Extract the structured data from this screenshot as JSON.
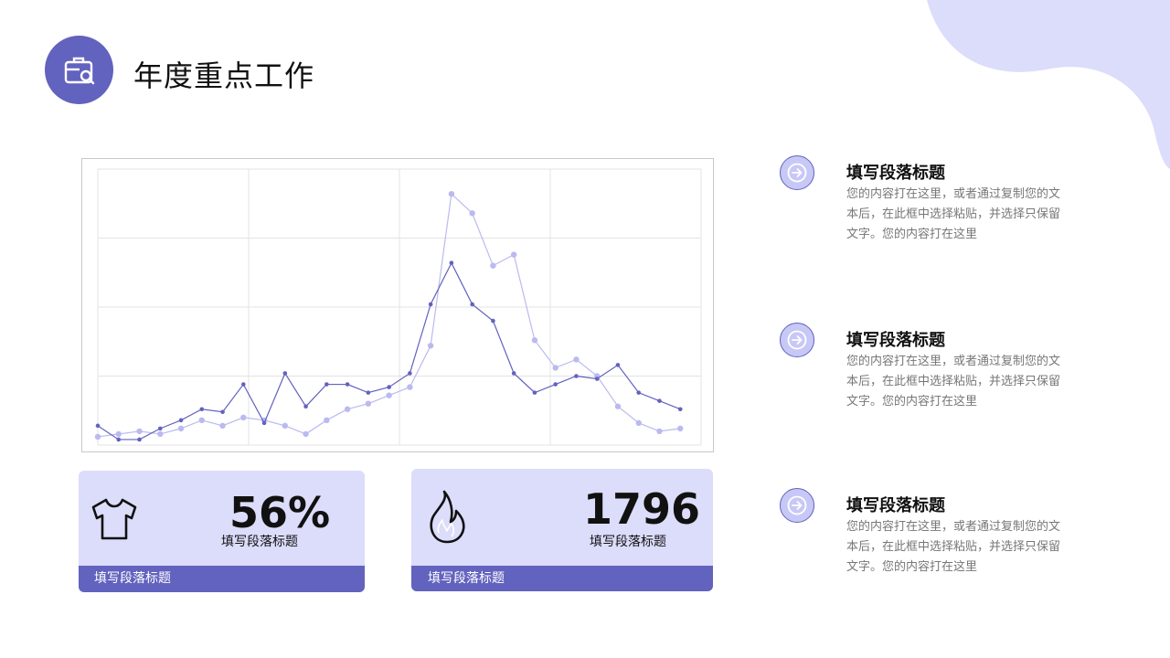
{
  "colors": {
    "accent": "#6262bf",
    "light_accent": "#dcdcfb",
    "series_light": "#babaf0"
  },
  "header": {
    "title": "年度重点工作",
    "icon": "briefcase-search-icon"
  },
  "chart_data": {
    "type": "line",
    "x": [
      1,
      2,
      3,
      4,
      5,
      6,
      7,
      8,
      9,
      10,
      11,
      12,
      13,
      14,
      15,
      16,
      17,
      18,
      19,
      20,
      21,
      22,
      23,
      24,
      25,
      26,
      27,
      28,
      29,
      30
    ],
    "ylim": [
      0,
      100
    ],
    "grid": true,
    "series": [
      {
        "color": "#6262bf",
        "values": [
          7,
          2,
          2,
          6,
          9,
          13,
          12,
          22,
          8,
          26,
          14,
          22,
          22,
          19,
          21,
          26,
          51,
          66,
          51,
          45,
          26,
          19,
          22,
          25,
          24,
          29,
          19,
          16,
          13
        ]
      },
      {
        "color": "#babaf0",
        "values": [
          3,
          4,
          5,
          4,
          6,
          9,
          7,
          10,
          9,
          7,
          4,
          9,
          13,
          15,
          18,
          21,
          36,
          91,
          84,
          65,
          69,
          38,
          28,
          31,
          25,
          14,
          8,
          5,
          6
        ]
      }
    ]
  },
  "cards": [
    {
      "icon": "t-shirt-icon",
      "value": "56%",
      "subtitle": "填写段落标题",
      "footer": "填写段落标题"
    },
    {
      "icon": "flame-icon",
      "value": "1796",
      "subtitle": "填写段落标题",
      "footer": "填写段落标题"
    }
  ],
  "items": [
    {
      "icon": "arrow-right-icon",
      "title": "填写段落标题",
      "body": "您的内容打在这里，或者通过复制您的文本后，在此框中选择粘贴，并选择只保留文字。您的内容打在这里"
    },
    {
      "icon": "arrow-right-icon",
      "title": "填写段落标题",
      "body": "您的内容打在这里，或者通过复制您的文本后，在此框中选择粘贴，并选择只保留文字。您的内容打在这里"
    },
    {
      "icon": "arrow-right-icon",
      "title": "填写段落标题",
      "body": "您的内容打在这里，或者通过复制您的文本后，在此框中选择粘贴，并选择只保留文字。您的内容打在这里"
    }
  ]
}
